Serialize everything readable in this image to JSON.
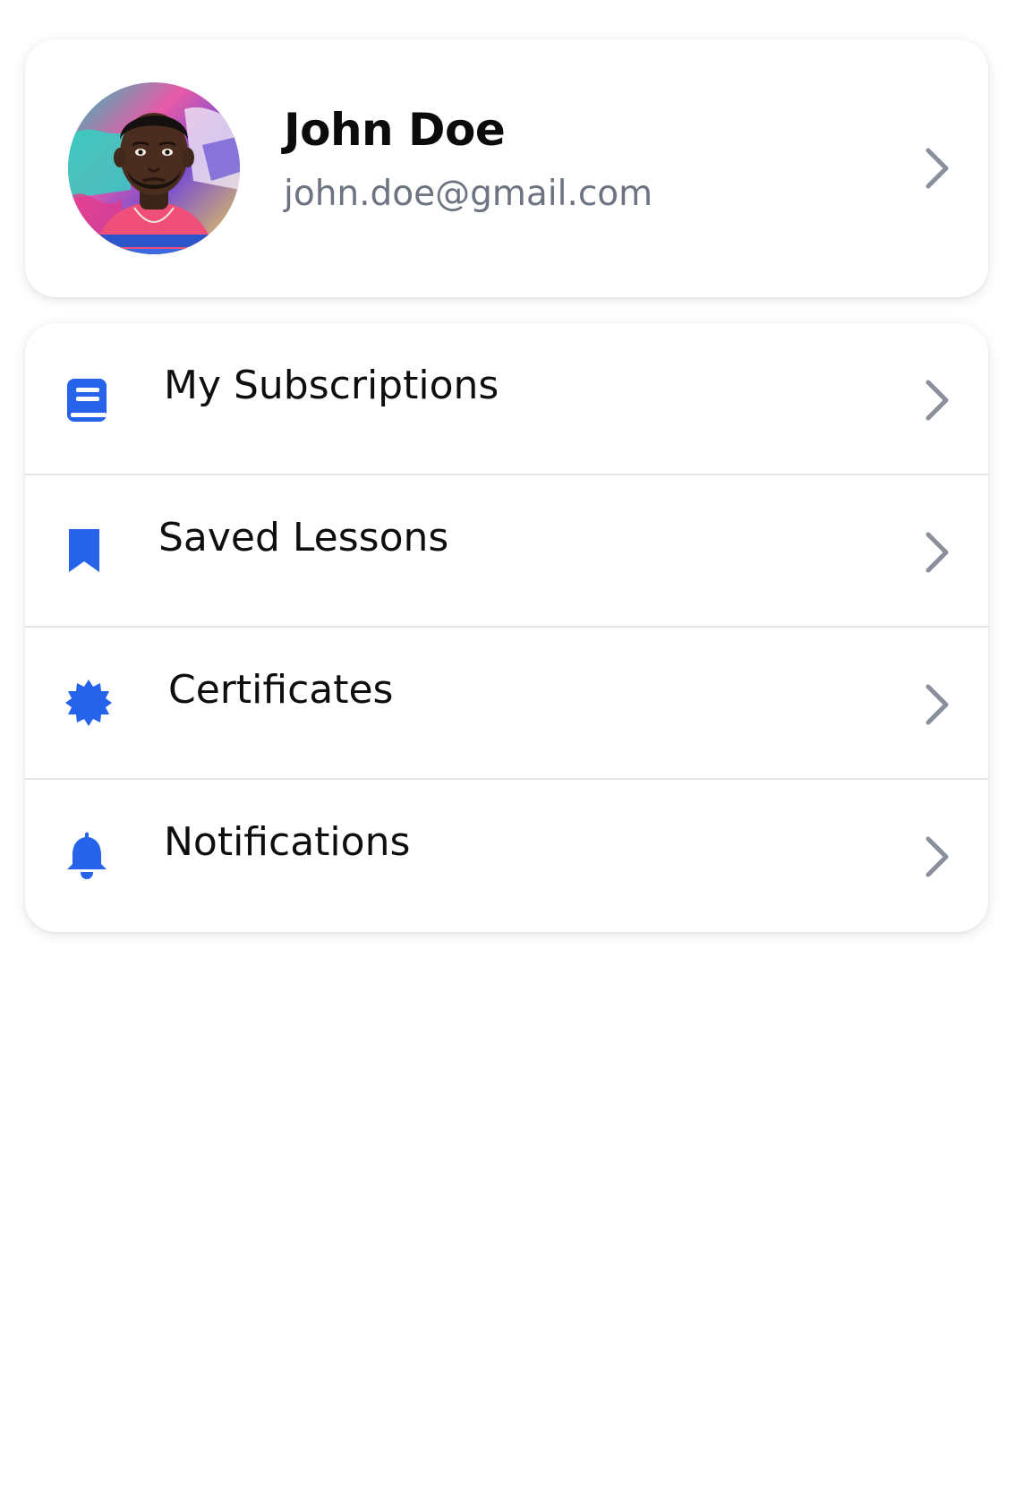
{
  "profile": {
    "name": "John Doe",
    "email": "john.doe@gmail.com",
    "avatar_icon": "user-avatar-photo",
    "chevron_icon": "chevron-right-icon"
  },
  "menu": {
    "items": [
      {
        "label": "My Subscriptions",
        "icon": "book-icon"
      },
      {
        "label": "Saved Lessons",
        "icon": "bookmark-icon"
      },
      {
        "label": "Certificates",
        "icon": "badge-icon"
      },
      {
        "label": "Notifications",
        "icon": "bell-icon"
      }
    ]
  },
  "colors": {
    "accent": "#2563eb",
    "chevron": "#8a8f9c",
    "email_text": "#6e7381",
    "divider": "#e3e4e8"
  }
}
